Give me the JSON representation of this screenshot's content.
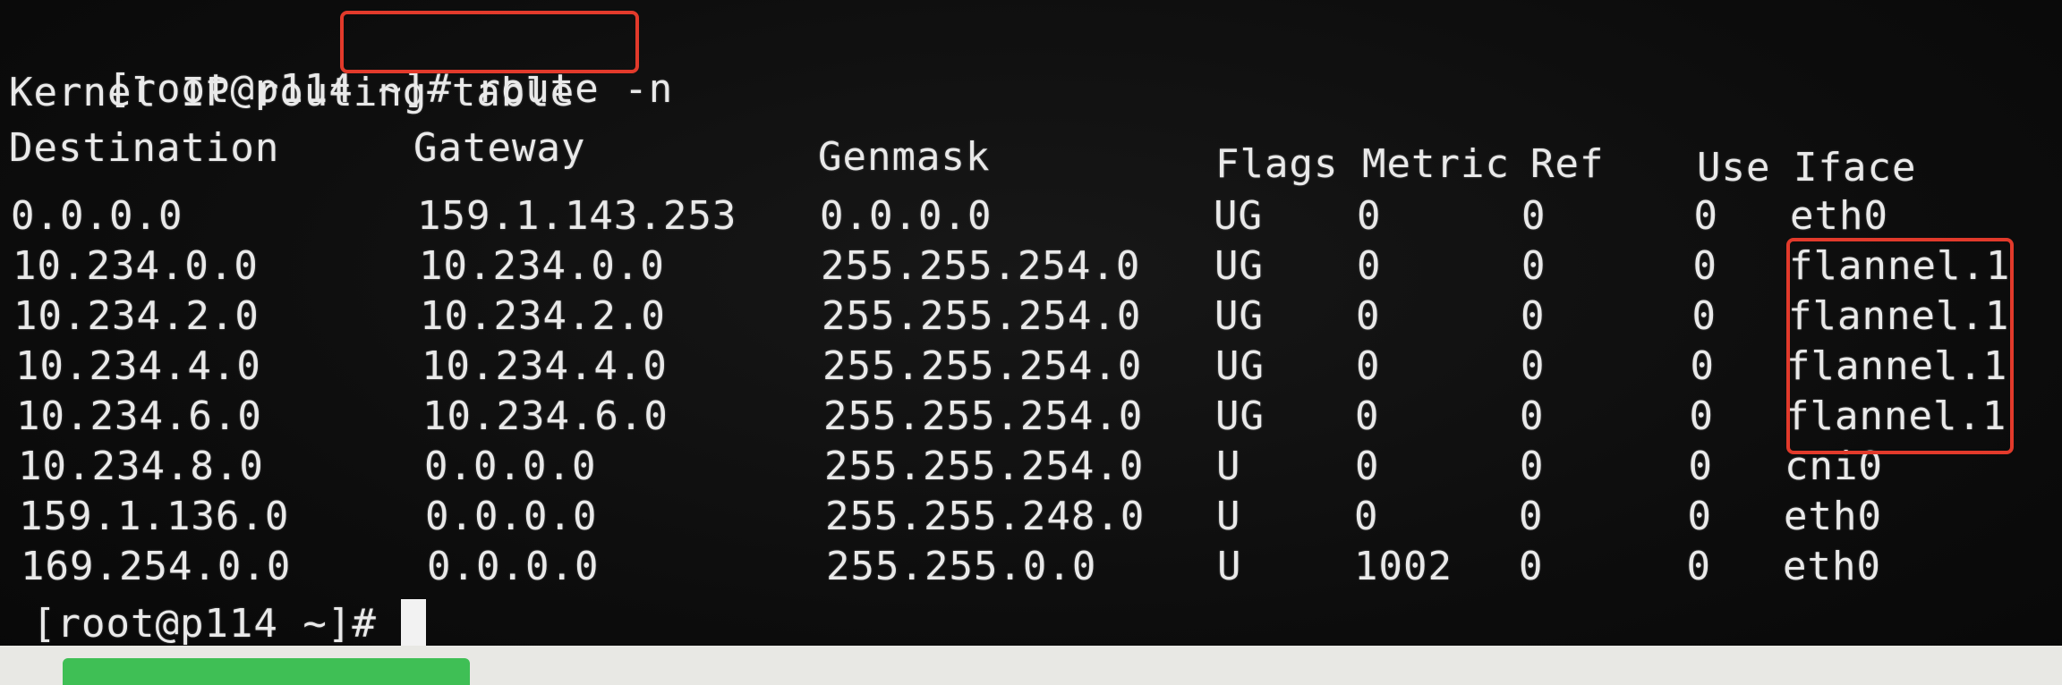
{
  "terminal": {
    "prompt": "[root@p114 ~]#",
    "command": " route -n",
    "title_line": "Kernel IP routing table",
    "final_prompt": "[root@p114 ~]#",
    "columns": {
      "destination": "Destination",
      "gateway": "Gateway",
      "genmask": "Genmask",
      "flags": "Flags",
      "metric": "Metric",
      "ref": "Ref",
      "use": "Use",
      "iface": "Iface"
    },
    "rows": [
      {
        "destination": "0.0.0.0",
        "gateway": "159.1.143.253",
        "genmask": "0.0.0.0",
        "flags": "UG",
        "metric": "0",
        "ref": "0",
        "use": "0",
        "iface": "eth0"
      },
      {
        "destination": "10.234.0.0",
        "gateway": "10.234.0.0",
        "genmask": "255.255.254.0",
        "flags": "UG",
        "metric": "0",
        "ref": "0",
        "use": "0",
        "iface": "flannel.1"
      },
      {
        "destination": "10.234.2.0",
        "gateway": "10.234.2.0",
        "genmask": "255.255.254.0",
        "flags": "UG",
        "metric": "0",
        "ref": "0",
        "use": "0",
        "iface": "flannel.1"
      },
      {
        "destination": "10.234.4.0",
        "gateway": "10.234.4.0",
        "genmask": "255.255.254.0",
        "flags": "UG",
        "metric": "0",
        "ref": "0",
        "use": "0",
        "iface": "flannel.1"
      },
      {
        "destination": "10.234.6.0",
        "gateway": "10.234.6.0",
        "genmask": "255.255.254.0",
        "flags": "UG",
        "metric": "0",
        "ref": "0",
        "use": "0",
        "iface": "flannel.1"
      },
      {
        "destination": "10.234.8.0",
        "gateway": "0.0.0.0",
        "genmask": "255.255.254.0",
        "flags": "U",
        "metric": "0",
        "ref": "0",
        "use": "0",
        "iface": "cni0"
      },
      {
        "destination": "159.1.136.0",
        "gateway": "0.0.0.0",
        "genmask": "255.255.248.0",
        "flags": "U",
        "metric": "0",
        "ref": "0",
        "use": "0",
        "iface": "eth0"
      },
      {
        "destination": "169.254.0.0",
        "gateway": "0.0.0.0",
        "genmask": "255.255.0.0",
        "flags": "U",
        "metric": "1002",
        "ref": "0",
        "use": "0",
        "iface": "eth0"
      }
    ]
  },
  "colors": {
    "background": "#0b0b0b",
    "text": "#e9e9e9",
    "highlight_box": "#e23a2b",
    "taskbar": "#e8e8e4",
    "taskbar_tab": "#3fbf55"
  }
}
